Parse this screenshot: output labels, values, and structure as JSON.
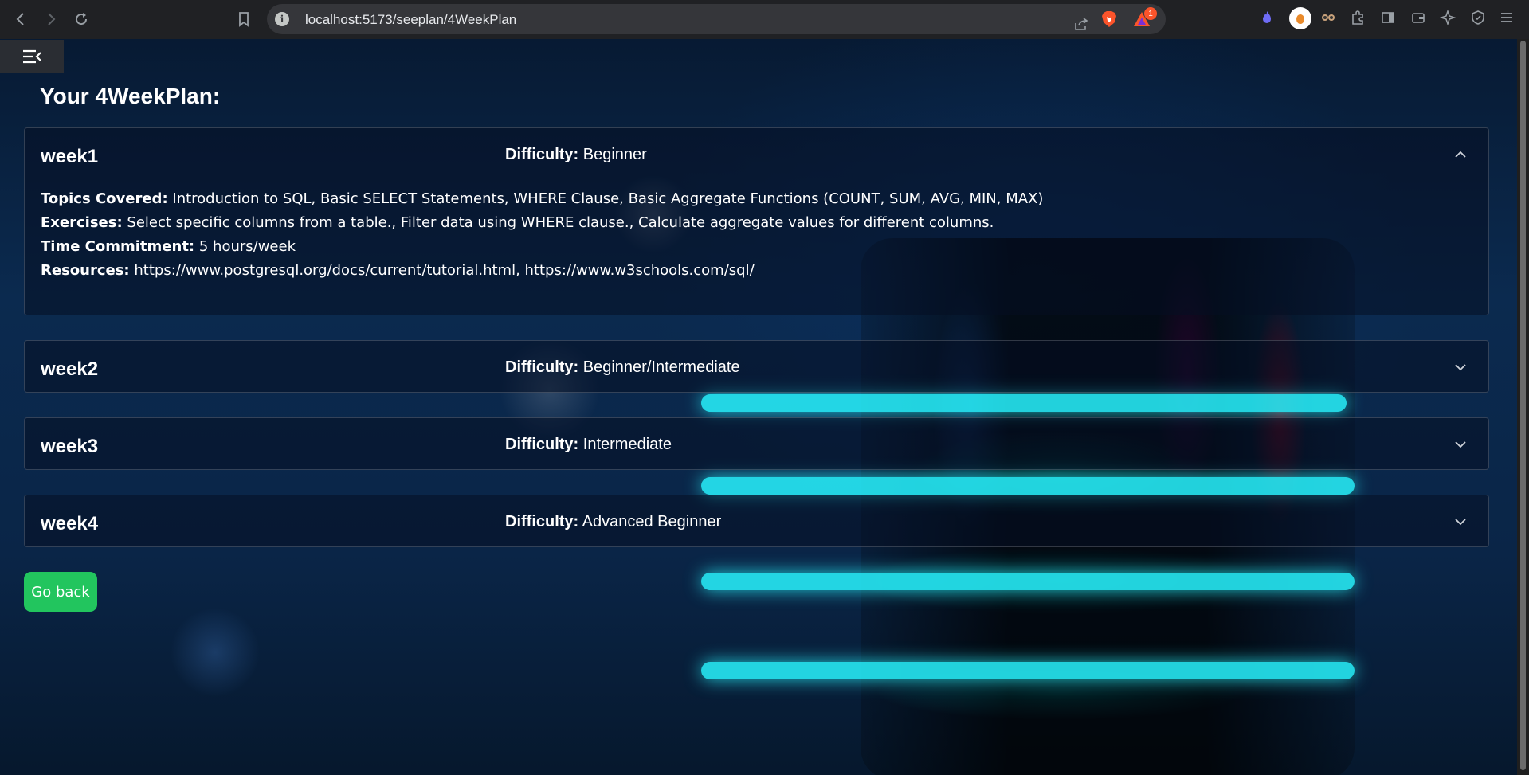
{
  "browser": {
    "url": "localhost:5173/seeplan/4WeekPlan",
    "rewards_badge": "1",
    "icons": [
      "back-icon",
      "forward-icon",
      "reload-icon",
      "bookmark-icon",
      "site-info-icon",
      "share-icon",
      "brave-shields-icon",
      "brave-rewards-icon",
      "extension-flame-icon",
      "extension-avatar-icon",
      "extension-glasses-icon",
      "puzzle-icon",
      "sidebar-panel-icon",
      "wallet-icon",
      "leo-ai-icon",
      "vpn-shield-icon",
      "menu-icon"
    ]
  },
  "page": {
    "title": "Your 4WeekPlan:",
    "difficulty_label": "Difficulty:",
    "go_back_label": "Go back",
    "weeks": [
      {
        "name": "week1",
        "difficulty": "Beginner",
        "expanded": true,
        "topics_label": "Topics Covered:",
        "topics": "Introduction to SQL, Basic SELECT Statements, WHERE Clause, Basic Aggregate Functions (COUNT, SUM, AVG, MIN, MAX)",
        "exercises_label": "Exercises:",
        "exercises": "Select specific columns from a table., Filter data using WHERE clause., Calculate aggregate values for different columns.",
        "time_label": "Time Commitment:",
        "time": "5 hours/week",
        "resources_label": "Resources:",
        "resources": "https://www.postgresql.org/docs/current/tutorial.html, https://www.w3schools.com/sql/"
      },
      {
        "name": "week2",
        "difficulty": "Beginner/Intermediate",
        "expanded": false
      },
      {
        "name": "week3",
        "difficulty": "Intermediate",
        "expanded": false
      },
      {
        "name": "week4",
        "difficulty": "Advanced Beginner",
        "expanded": false
      }
    ]
  },
  "colors": {
    "accent_button": "#22c55e",
    "chrome_bg": "#202124",
    "urlbar_bg": "#35363a"
  }
}
